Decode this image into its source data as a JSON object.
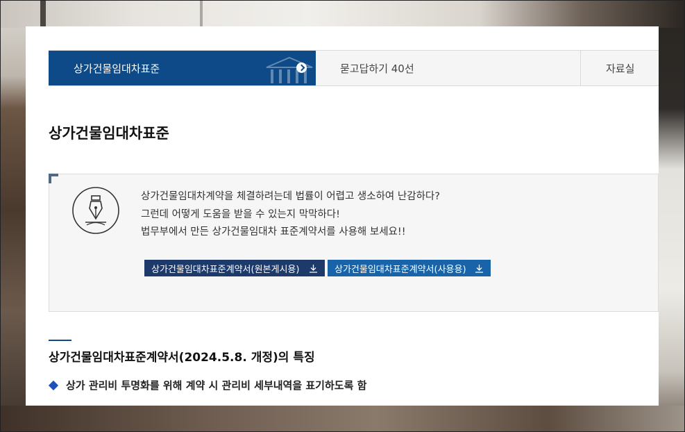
{
  "tabs": {
    "items": [
      {
        "label": "상가건물임대차표준",
        "active": true
      },
      {
        "label": "묻고답하기 40선",
        "active": false
      },
      {
        "label": "자료실",
        "active": false
      }
    ]
  },
  "page": {
    "title": "상가건물임대차표준"
  },
  "info": {
    "lines": [
      "상가건물임대차계약을 체결하려는데 법률이 어렵고 생소하여 난감하다?",
      "그런데 어떻게 도움을 받을 수 있는지 막막하다!",
      "법무부에서 만든 상가건물임대차 표준계약서를 사용해 보세요!!"
    ],
    "downloads": [
      {
        "label": "상가건물임대차표준계약서(원본게시용)",
        "icon": "download-icon",
        "color": "#1d3a6b"
      },
      {
        "label": "상가건물임대차표준계약서(사용용)",
        "icon": "download-icon",
        "color": "#1964a8"
      }
    ]
  },
  "section": {
    "title": "상가건물임대차표준계약서(2024.5.8. 개정)의 특징",
    "features": [
      "상가 관리비 투명화를 위해 계약 시 관리비 세부내역을 표기하도록 함"
    ]
  },
  "colors": {
    "primary": "#0e4a87",
    "dark_button": "#1d3a6b",
    "light_button": "#1964a8",
    "bullet": "#1f4fb8"
  }
}
